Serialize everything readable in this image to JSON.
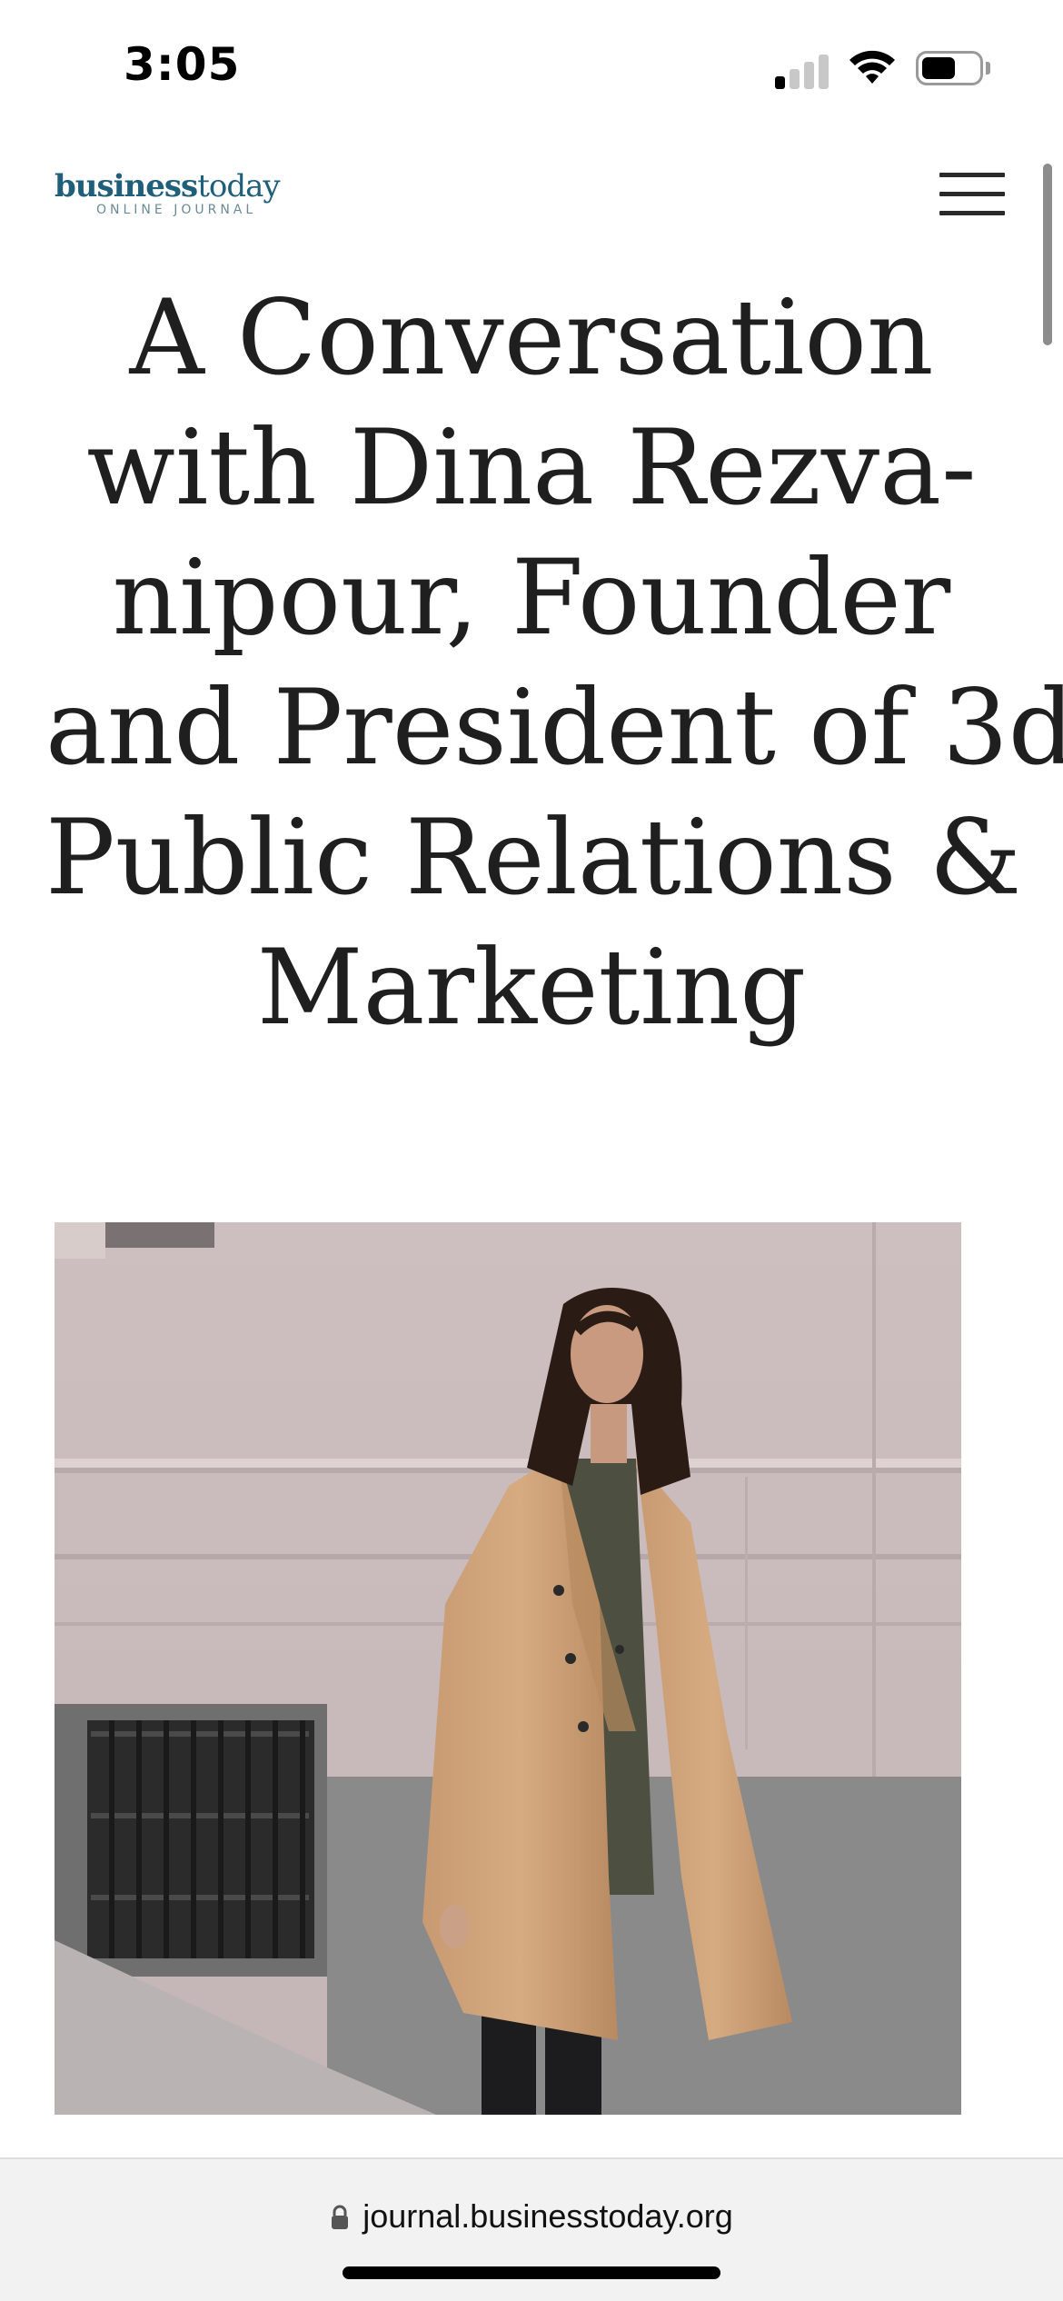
{
  "status_bar": {
    "time": "3:05",
    "signal_bars_active": 1,
    "signal_bars_total": 4,
    "battery_level": 0.6,
    "icons": [
      "cellular-signal-icon",
      "wifi-icon",
      "battery-icon"
    ]
  },
  "header": {
    "logo_bold": "business",
    "logo_light": "today",
    "logo_subtitle": "ONLINE JOURNAL",
    "logo_color": "#1f5f7a",
    "menu_icon": "hamburger-menu-icon"
  },
  "article": {
    "headline_lines": [
      "A Conversation",
      "with Dina Rezva-",
      "nipour, Founder",
      "and President of 3d",
      "Public Relations &",
      "Marketing"
    ],
    "hero_image": {
      "subject": "woman-in-camel-coat-photo"
    }
  },
  "browser": {
    "url": "journal.businesstoday.org",
    "lock_icon": "lock-icon"
  }
}
